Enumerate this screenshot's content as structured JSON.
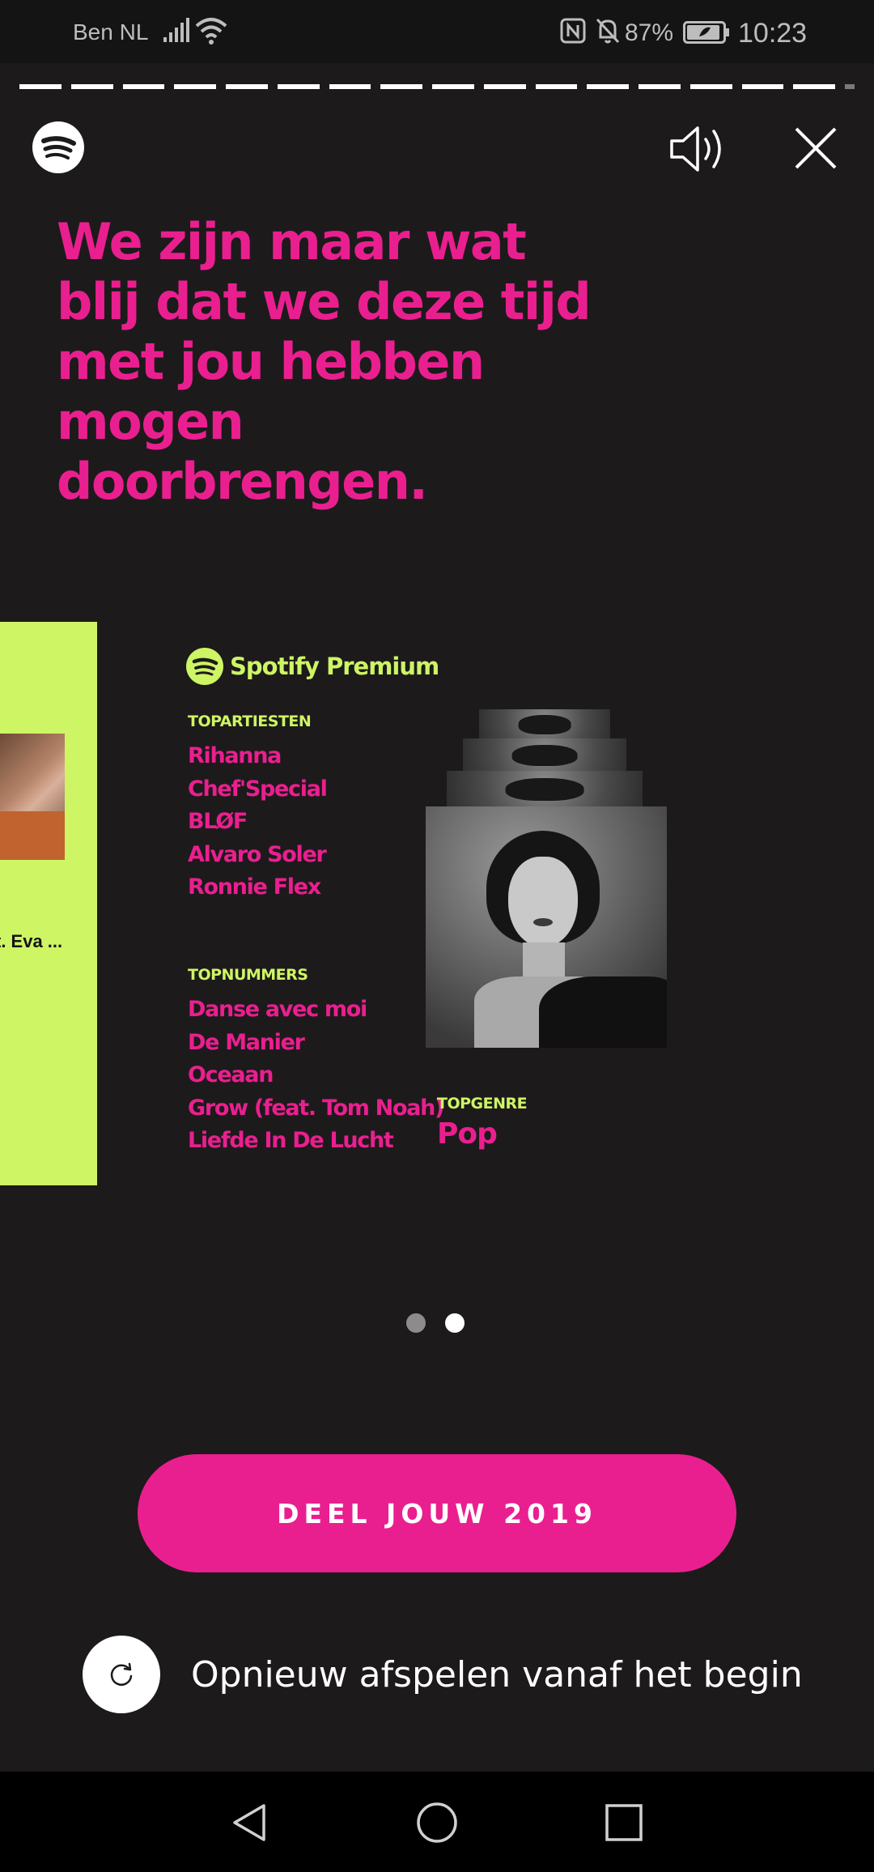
{
  "status_bar": {
    "carrier": "Ben NL",
    "battery_percent": "87%",
    "time": "10:23",
    "icons": [
      "signal-icon",
      "wifi-icon",
      "nfc-icon",
      "bell-muted-icon",
      "battery-icon"
    ]
  },
  "story_progress": {
    "segments_total": 16,
    "segments_completed": 16
  },
  "header": {
    "logo": "spotify-logo-icon",
    "volume_icon": "volume-icon",
    "close_icon": "close-icon"
  },
  "headline": "We zijn maar wat blij dat we deze tijd met jou hebben mogen doorbrengen.",
  "prev_card": {
    "label": "t. Eva ..."
  },
  "card": {
    "brand": "Spotify Premium",
    "top_artists_label": "TOPARTIESTEN",
    "top_artists": [
      "Rihanna",
      "Chef'Special",
      "BLØF",
      "Alvaro Soler",
      "Ronnie Flex"
    ],
    "top_songs_label": "TOPNUMMERS",
    "top_songs": [
      "Danse avec moi",
      "De Manier",
      "Oceaan",
      "Grow (feat. Tom Noah)",
      "Liefde In De Lucht"
    ],
    "top_genre_label": "TOPGENRE",
    "top_genre": "Pop"
  },
  "pagination": {
    "pages": 2,
    "active": 2
  },
  "share_button": "DEEL JOUW 2019",
  "replay": {
    "icon": "replay-icon",
    "label": "Opnieuw afspelen vanaf het begin"
  },
  "nav_bar": {
    "icons": [
      "back-icon",
      "home-icon",
      "recents-icon"
    ]
  },
  "colors": {
    "background": "#1d1a1b",
    "accent_pink": "#ea1f8f",
    "accent_green": "#cdf564",
    "status_bar": "#141414"
  }
}
